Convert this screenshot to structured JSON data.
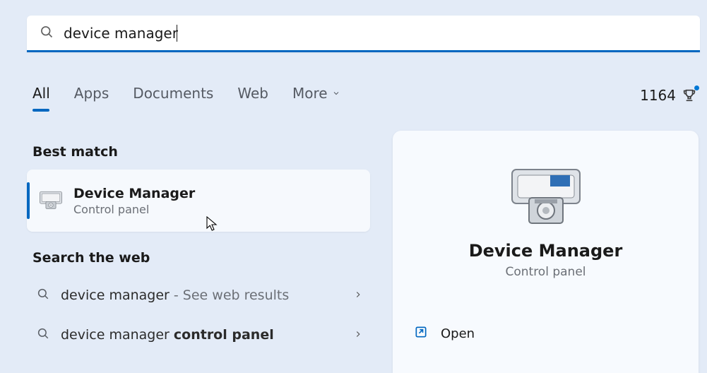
{
  "search": {
    "query": "device manager"
  },
  "tabs": {
    "all": "All",
    "apps": "Apps",
    "documents": "Documents",
    "web": "Web",
    "more": "More"
  },
  "rewards": {
    "points": "1164"
  },
  "sections": {
    "best_match": "Best match",
    "search_web": "Search the web"
  },
  "best_match": {
    "title": "Device Manager",
    "subtitle": "Control panel"
  },
  "web_results": [
    {
      "prefix": "device manager",
      "hint": " - See web results",
      "bold": ""
    },
    {
      "prefix": "device manager ",
      "hint": "",
      "bold": "control panel"
    }
  ],
  "detail": {
    "title": "Device Manager",
    "subtitle": "Control panel",
    "open": "Open"
  }
}
